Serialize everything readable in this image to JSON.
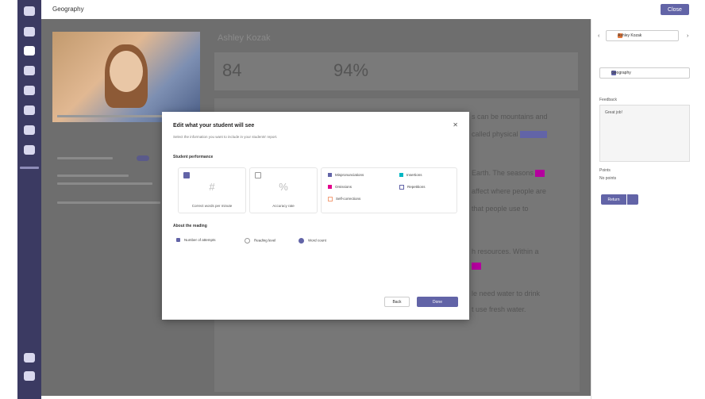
{
  "window": {
    "title": "Geography",
    "close_label": "Close"
  },
  "student": {
    "name": "Ashley Kozak"
  },
  "stats": {
    "correct_words_per_minute": "84",
    "accuracy": "94%"
  },
  "article_lines": [
    "s can be mountains and",
    "called physical",
    "Earth. The seasons",
    "affect where people are",
    "that people use to",
    "h resources. Within a",
    "le need water to drink",
    "t use fresh water."
  ],
  "right_panel": {
    "student_name": "Ashley Kozak",
    "assignment": "Geography",
    "feedback_label": "Feedback",
    "feedback_text": "Great job!",
    "points_label": "Points",
    "points_value": "No points",
    "return_label": "Return"
  },
  "modal": {
    "title": "Edit what your student will see",
    "subtitle": "Select the information you want to include in your students' report.",
    "section_performance": "Student performance",
    "cards": [
      {
        "label": "Correct words per minute",
        "symbol": "#",
        "checked": true
      },
      {
        "label": "Accuracy rate",
        "symbol": "%",
        "checked": false
      }
    ],
    "legend": [
      {
        "label": "Mispronunciations",
        "color": "#6264a7"
      },
      {
        "label": "Insertions",
        "color": "#00b7c3"
      },
      {
        "label": "Omissions",
        "color": "#e3008c"
      },
      {
        "label": "Repetitions",
        "color": "#ffffff"
      },
      {
        "label": "Self-corrections",
        "color": "#ffffff"
      }
    ],
    "section_reading": "About the reading",
    "reading_options": [
      {
        "label": "Number of attempts",
        "type": "check",
        "on": true
      },
      {
        "label": "Reading level",
        "type": "radio",
        "on": false
      },
      {
        "label": "Word count",
        "type": "radio",
        "on": true
      }
    ],
    "back_label": "Back",
    "done_label": "Done"
  }
}
